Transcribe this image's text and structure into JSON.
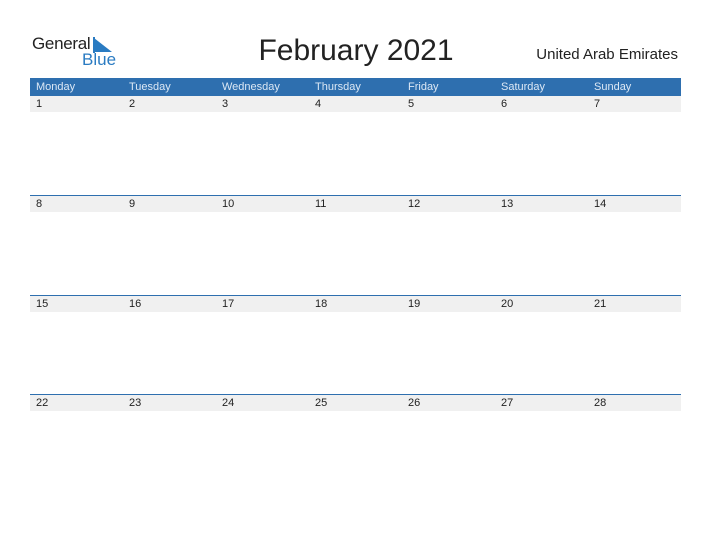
{
  "logo": {
    "line1": "General",
    "line2": "Blue"
  },
  "title": "February 2021",
  "country": "United Arab Emirates",
  "colors": {
    "accent": "#2e6faf",
    "row_bg": "#f0f0f0"
  },
  "weekdays": [
    "Monday",
    "Tuesday",
    "Wednesday",
    "Thursday",
    "Friday",
    "Saturday",
    "Sunday"
  ],
  "weeks": [
    [
      "1",
      "2",
      "3",
      "4",
      "5",
      "6",
      "7"
    ],
    [
      "8",
      "9",
      "10",
      "11",
      "12",
      "13",
      "14"
    ],
    [
      "15",
      "16",
      "17",
      "18",
      "19",
      "20",
      "21"
    ],
    [
      "22",
      "23",
      "24",
      "25",
      "26",
      "27",
      "28"
    ]
  ]
}
